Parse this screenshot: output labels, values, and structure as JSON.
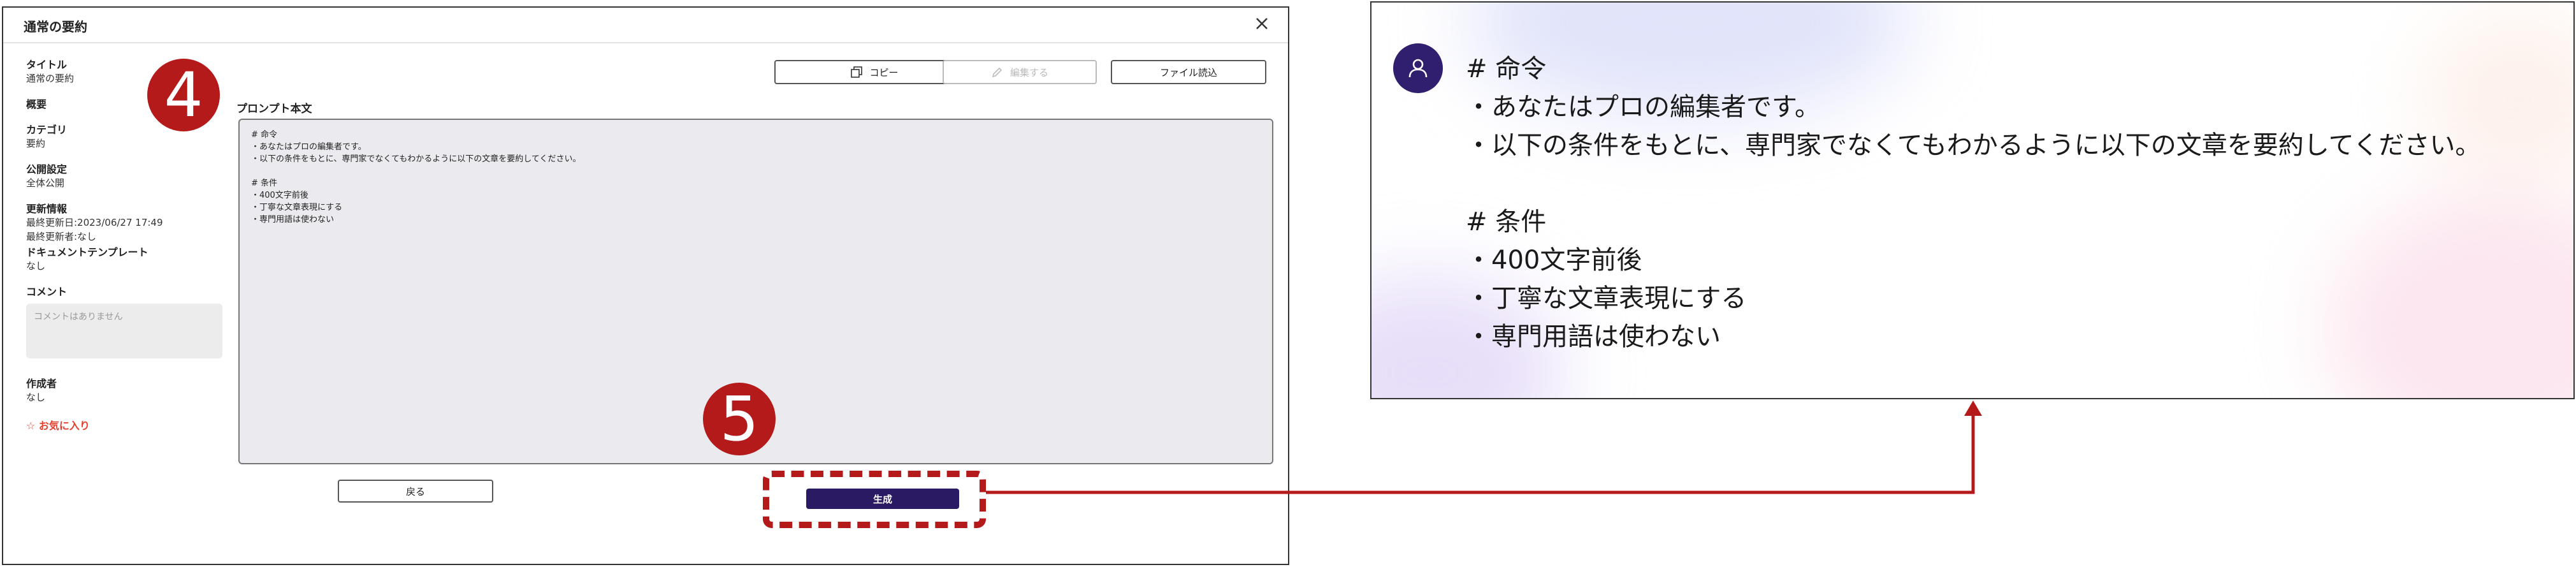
{
  "dialog": {
    "title": "通常の要約",
    "close_label": "×"
  },
  "sidebar": {
    "title_label": "タイトル",
    "title_value": "通常の要約",
    "summary_label": "概要",
    "category_label": "カテゴリ",
    "category_value": "要約",
    "visibility_label": "公開設定",
    "visibility_value": "全体公開",
    "update_label": "更新情報",
    "last_updated": "最終更新日:2023/06/27 17:49",
    "last_updater": "最終更新者:なし",
    "template_label": "ドキュメントテンプレート",
    "template_value": "なし",
    "comment_label": "コメント",
    "comment_placeholder": "コメントはありません",
    "author_label": "作成者",
    "author_value": "なし",
    "favorite_label": "☆ お気に入り"
  },
  "toolbar": {
    "copy_label": "コピー",
    "edit_label": "編集する",
    "file_label": "ファイル読込"
  },
  "prompt": {
    "label": "プロンプト本文",
    "lines": [
      "# 命令",
      "・あなたはプロの編集者です。",
      "・以下の条件をもとに、専門家でなくてもわかるように以下の文章を要約してください。",
      "",
      "# 条件",
      "・400文字前後",
      "・丁寧な文章表現にする",
      "・専門用語は使わない"
    ]
  },
  "actions": {
    "back_label": "戻る",
    "generate_label": "生成"
  },
  "steps": {
    "step4": "4",
    "step5": "5"
  },
  "output": {
    "lines": [
      "# 命令",
      "・あなたはプロの編集者です。",
      "・以下の条件をもとに、専門家でなくてもわかるように以下の文章を要約してください。",
      "",
      "# 条件",
      "・400文字前後",
      "・丁寧な文章表現にする",
      "・専門用語は使わない"
    ]
  },
  "colors": {
    "accent_red": "#b51a1a",
    "primary_navy": "#2a1a63",
    "favorite_red": "#e3402e"
  }
}
